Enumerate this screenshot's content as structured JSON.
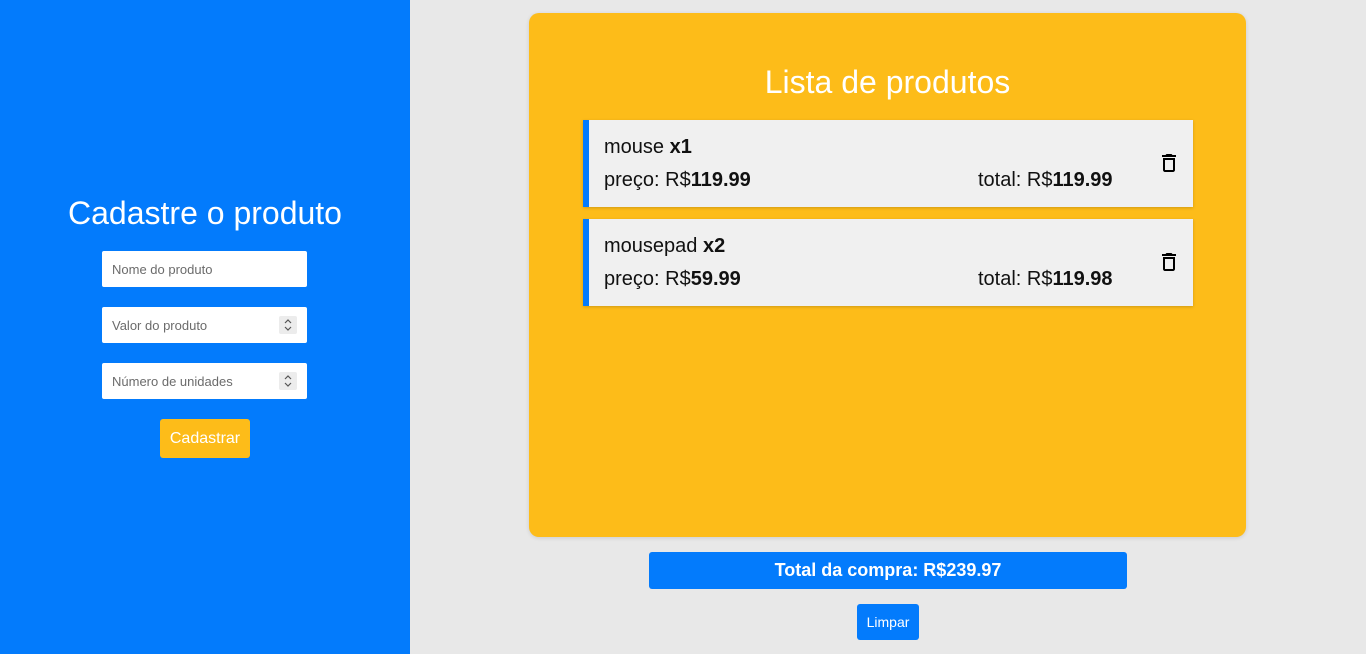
{
  "colors": {
    "sidebar_bg": "#037bfc",
    "accent_yellow": "#fdbc19",
    "page_bg": "#e8e8e8",
    "item_bg": "#f0f0f0"
  },
  "form": {
    "title": "Cadastre o produto",
    "name_placeholder": "Nome do produto",
    "value_placeholder": "Valor do produto",
    "units_placeholder": "Número de unidades",
    "submit_label": "Cadastrar"
  },
  "list": {
    "title": "Lista de produtos",
    "price_label": "preço: R$",
    "total_label": "total: R$",
    "items": [
      {
        "name": "mouse",
        "qty": "x1",
        "price": "119.99",
        "total": "119.99",
        "delete_icon": "trash-icon"
      },
      {
        "name": "mousepad",
        "qty": "x2",
        "price": "59.99",
        "total": "119.98",
        "delete_icon": "trash-icon"
      }
    ]
  },
  "summary": {
    "total_text": "Total da compra: R$239.97",
    "clear_label": "Limpar"
  }
}
